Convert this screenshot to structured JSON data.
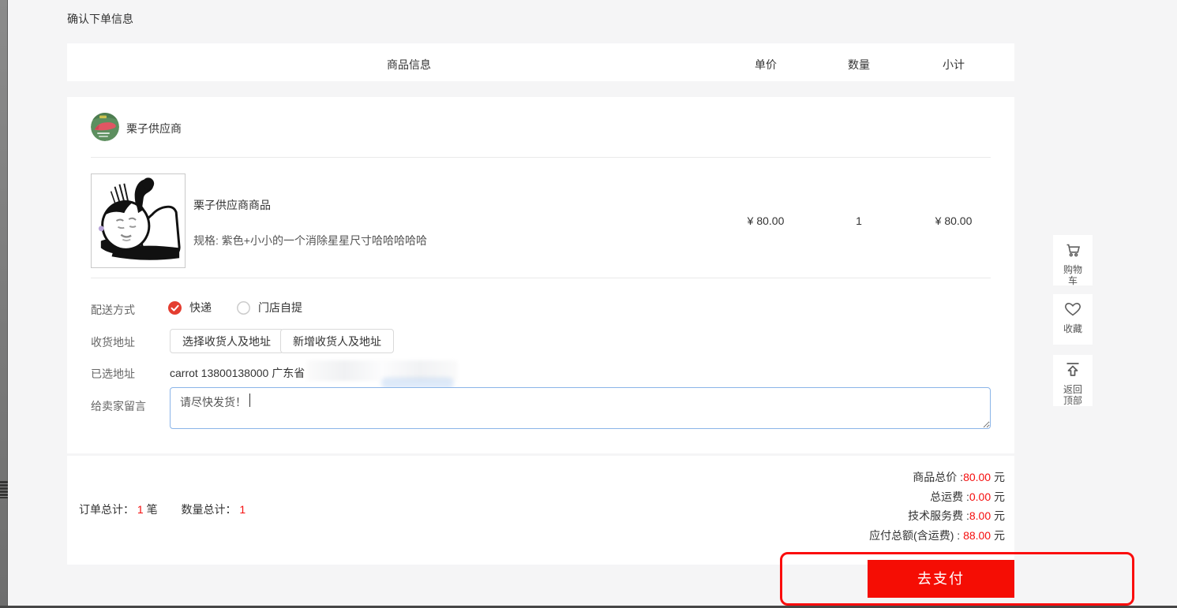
{
  "colors": {
    "accent_red": "#f50d0d",
    "button_red": "#f50d04",
    "focus_blue": "#8ab4e8"
  },
  "page": {
    "title": "确认下单信息"
  },
  "table_header": {
    "product": "商品信息",
    "unit_price": "单价",
    "quantity": "数量",
    "subtotal": "小计"
  },
  "seller": {
    "name": "栗子供应商",
    "avatar_icon": "seller-avatar"
  },
  "product": {
    "name": "栗子供应商商品",
    "spec": "规格: 紫色+小小的一个消除星星尺寸哈哈哈哈哈",
    "unit_price": "¥ 80.00",
    "quantity": "1",
    "subtotal": "¥ 80.00"
  },
  "delivery": {
    "label": "配送方式",
    "options": [
      {
        "label": "快递",
        "selected": true
      },
      {
        "label": "门店自提",
        "selected": false
      }
    ]
  },
  "address": {
    "label": "收货地址",
    "choose_button": "选择收货人及地址",
    "add_button": "新增收货人及地址",
    "selected_label": "已选地址",
    "selected_value": "carrot 13800138000 广东省"
  },
  "message": {
    "label": "给卖家留言",
    "value": "请尽快发货！"
  },
  "summary": {
    "order_total_label": "订单总计：",
    "order_total_value": "1",
    "order_total_unit": "笔",
    "qty_total_label": "数量总计：",
    "qty_total_value": "1",
    "lines": [
      {
        "label": "商品总价 :",
        "value": "80.00",
        "unit": " 元"
      },
      {
        "label": "总运费 :",
        "value": "0.00",
        "unit": " 元"
      },
      {
        "label": "技术服务费 :",
        "value": "8.00",
        "unit": " 元"
      },
      {
        "label": "应付总额(含运费) : ",
        "value": "88.00",
        "unit": " 元"
      }
    ],
    "pay_button": "去支付"
  },
  "side_toolbar": {
    "cart_label": "购物车",
    "favorite_label": "收藏",
    "back_top_label": "返回顶部"
  }
}
